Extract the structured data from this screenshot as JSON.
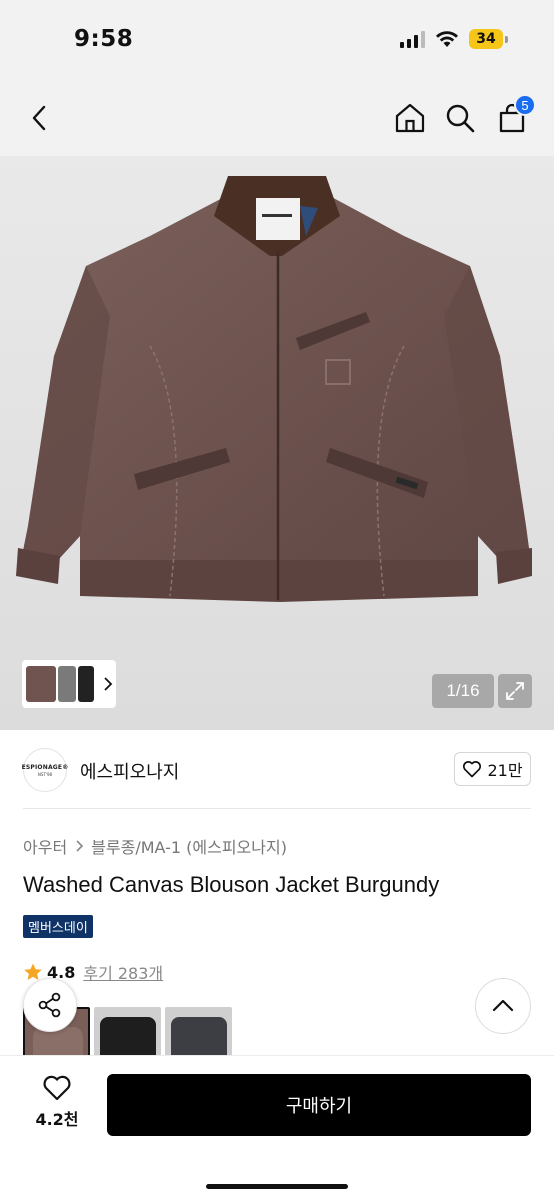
{
  "status_bar": {
    "time": "9:58",
    "battery_level": "34",
    "icons": [
      "signal-icon",
      "wifi-icon",
      "battery-icon"
    ]
  },
  "nav": {
    "icons": [
      "back-chevron-icon",
      "home-icon",
      "search-icon",
      "cart-icon"
    ],
    "cart_count": "5"
  },
  "gallery": {
    "counter": "1/16",
    "icons": [
      "expand-icon",
      "chevron-right-icon"
    ],
    "product_color_hex": "#6f5450"
  },
  "brand": {
    "logo_line1": "ESPIONAGE®",
    "logo_line2": "NST'98",
    "name": "에스피오나지",
    "like_count": "21만"
  },
  "breadcrumb": {
    "category": "아우터",
    "subcategory": "블루종/MA-1 (에스피오나지)"
  },
  "product": {
    "title": "Washed Canvas Blouson Jacket Burgundy",
    "badge": "멤버스데이",
    "rating": "4.8",
    "reviews": "후기 283개"
  },
  "colors": {
    "accent_badge": "#0f3366",
    "cart_badge": "#1a6cf0",
    "rating_star": "#f5a623"
  },
  "bottom_bar": {
    "wish_count": "4.2천",
    "buy_label": "구매하기"
  }
}
